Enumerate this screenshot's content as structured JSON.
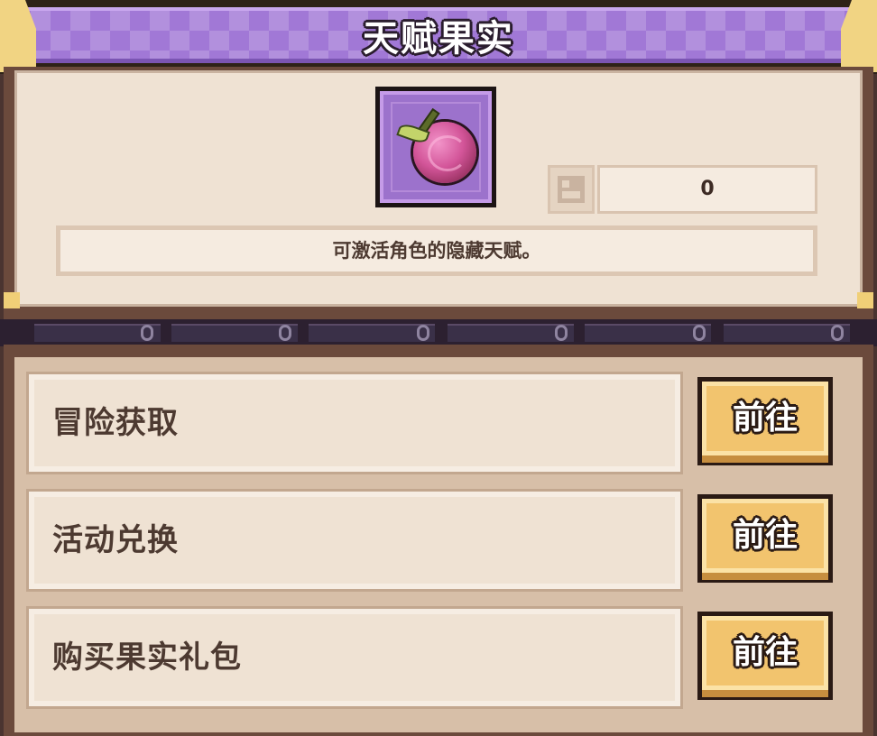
{
  "header": {
    "title": "天赋果实"
  },
  "item": {
    "icon": "talent-fruit-icon",
    "count_icon": "inventory-icon",
    "count": "0",
    "description": "可激活角色的隐藏天赋。"
  },
  "sources": [
    {
      "label": "冒险获取",
      "button": "前往"
    },
    {
      "label": "活动兑换",
      "button": "前往"
    },
    {
      "label": "购买果实礼包",
      "button": "前往"
    }
  ],
  "colors": {
    "banner": "#a178d6",
    "panel": "#efe2d3",
    "button": "#f2c46e",
    "frame": "#6b4a3c"
  }
}
